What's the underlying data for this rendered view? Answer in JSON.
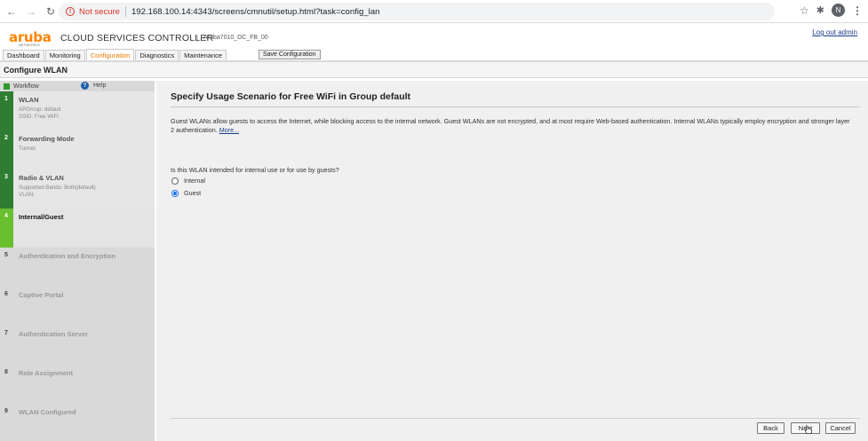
{
  "browser": {
    "back_icon": "arrow-left-icon",
    "forward_icon": "arrow-right-icon",
    "reload_icon": "reload-icon",
    "security_label": "Not secure",
    "url": "192.168.100.14:4343/screens/cmnutil/setup.html?task=config_lan",
    "profile_initial": "N"
  },
  "header": {
    "logo": "aruba",
    "logo_sub": "NETWORKS",
    "product": "CLOUD SERVICES CONTROLLER",
    "separator": "|",
    "hostname": "Aruba7010_DC_FB_00",
    "logout": "Log out admin"
  },
  "tabs": [
    {
      "label": "Dashboard",
      "active": false
    },
    {
      "label": "Monitoring",
      "active": false
    },
    {
      "label": "Configuration",
      "active": true
    },
    {
      "label": "Diagnostics",
      "active": false
    },
    {
      "label": "Maintenance",
      "active": false
    }
  ],
  "save_config": "Save Configuration",
  "page_title": "Configure WLAN",
  "workflow": {
    "label": "Workflow",
    "help": "Help",
    "steps": [
      {
        "num": "1",
        "name": "WLAN",
        "sub": [
          "APGroup: default",
          "SSID: Free WiFi"
        ],
        "state": "done"
      },
      {
        "num": "2",
        "name": "Forwarding Mode",
        "sub": [
          "Tunnel"
        ],
        "state": "done"
      },
      {
        "num": "3",
        "name": "Radio & VLAN",
        "sub": [
          "Supported Bands: Both(default)",
          "VLAN:"
        ],
        "state": "done"
      },
      {
        "num": "4",
        "name": "Internal/Guest",
        "sub": [],
        "state": "current"
      },
      {
        "num": "5",
        "name": "Authentication and Encryption",
        "sub": [],
        "state": "todo"
      },
      {
        "num": "6",
        "name": "Captive Portal",
        "sub": [],
        "state": "todo"
      },
      {
        "num": "7",
        "name": "Authentication Server",
        "sub": [],
        "state": "todo"
      },
      {
        "num": "8",
        "name": "Role Assignment",
        "sub": [],
        "state": "todo"
      },
      {
        "num": "9",
        "name": "WLAN Configured",
        "sub": [],
        "state": "todo"
      }
    ]
  },
  "main": {
    "heading": "Specify Usage Scenario for Free WiFi in Group default",
    "description": "Guest WLANs allow guests to access the Internet, while blocking access to the internal network. Guest WLANs are not encrypted, and at most require Web-based authentication. Internal WLANs typically employ encryption and stronger layer 2 authentication.",
    "more_link": "More...",
    "question": "Is this WLAN intended for internal use or for use by guests?",
    "options": [
      {
        "label": "Internal",
        "checked": false
      },
      {
        "label": "Guest",
        "checked": true
      }
    ]
  },
  "buttons": {
    "back": "Back",
    "next": "Next",
    "cancel": "Cancel"
  },
  "colors": {
    "accent": "#ff8300",
    "step_done": "#2e7d32",
    "step_current": "#6abf2e",
    "link": "#1a3c8c"
  }
}
